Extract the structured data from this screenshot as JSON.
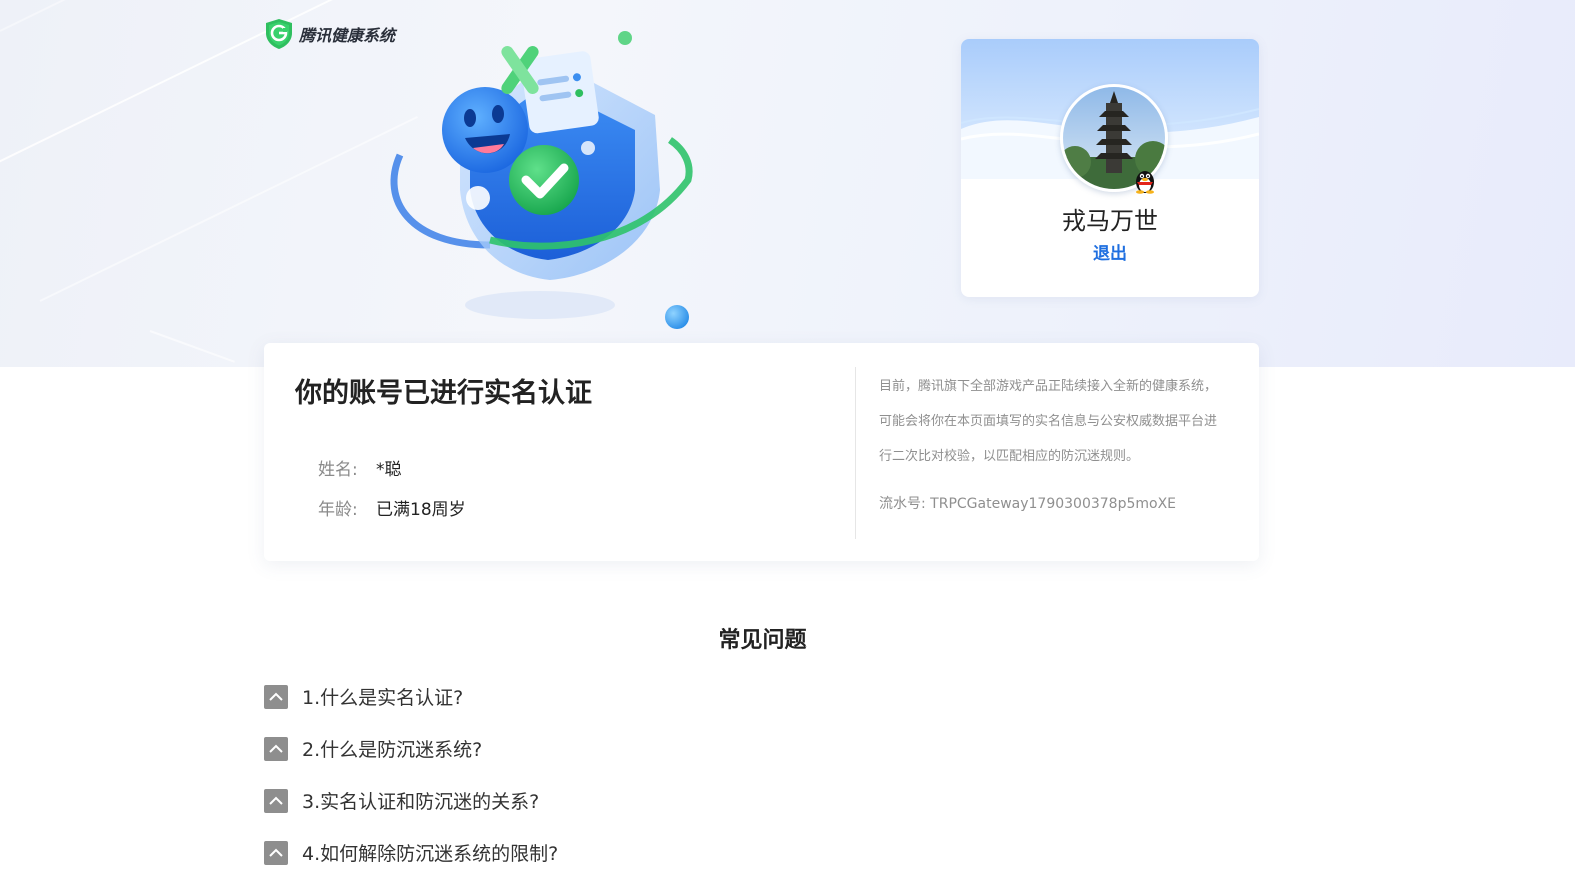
{
  "header": {
    "logo_text": "腾讯健康系统"
  },
  "profile": {
    "name": "戎马万世",
    "logout_label": "退出"
  },
  "verification": {
    "title": "你的账号已进行实名认证",
    "fields": [
      {
        "label": "姓名:",
        "value": "*聪"
      },
      {
        "label": "年龄:",
        "value": "已满18周岁"
      }
    ],
    "note": "目前，腾讯旗下全部游戏产品正陆续接入全新的健康系统，可能会将你在本页面填写的实名信息与公安权威数据平台进行二次比对校验，以匹配相应的防沉迷规则。",
    "serial": "流水号: TRPCGateway1790300378p5moXE"
  },
  "faq": {
    "heading": "常见问题",
    "items": [
      {
        "label": "1.什么是实名认证?"
      },
      {
        "label": "2.什么是防沉迷系统?"
      },
      {
        "label": "3.实名认证和防沉迷的关系?"
      },
      {
        "label": "4.如何解除防沉迷系统的限制?"
      }
    ]
  },
  "colors": {
    "accent": "#1f6fe0",
    "brand_green": "#2fbf5f",
    "toggle_gray": "#8e8e8e"
  },
  "icons": {
    "logo": "shield-g-logo-icon",
    "avatar_badge": "qq-penguin-icon",
    "faq_toggle": "chevron-up-icon"
  }
}
